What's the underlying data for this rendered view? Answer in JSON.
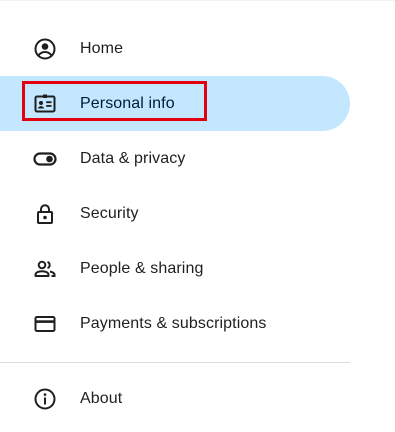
{
  "nav": {
    "items": [
      {
        "label": "Home",
        "icon": "account-circle-icon",
        "active": false
      },
      {
        "label": "Personal info",
        "icon": "id-card-icon",
        "active": true
      },
      {
        "label": "Data & privacy",
        "icon": "toggle-icon",
        "active": false
      },
      {
        "label": "Security",
        "icon": "lock-icon",
        "active": false
      },
      {
        "label": "People & sharing",
        "icon": "people-icon",
        "active": false
      },
      {
        "label": "Payments & subscriptions",
        "icon": "credit-card-icon",
        "active": false
      }
    ],
    "about": {
      "label": "About",
      "icon": "info-icon"
    }
  },
  "colors": {
    "active_background": "#c2e7ff",
    "highlight_border": "#e3000f",
    "icon": "#1f1f1f",
    "text": "#1f1f1f"
  }
}
